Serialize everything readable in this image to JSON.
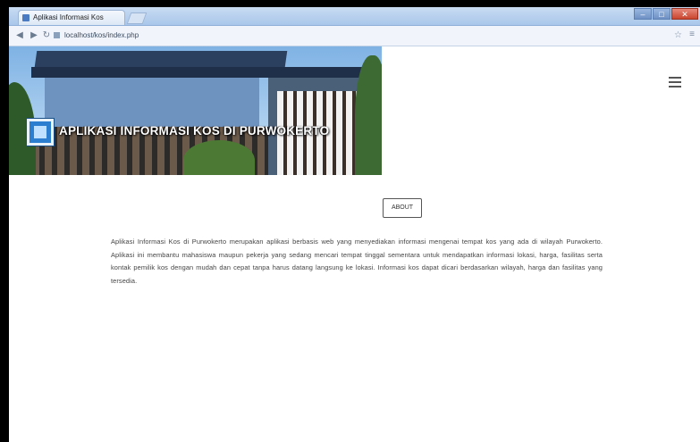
{
  "browser": {
    "tab_title": "Aplikasi Informasi Kos",
    "url": "localhost/kos/index.php",
    "controls": {
      "minimize": "–",
      "maximize": "□",
      "close": "✕"
    },
    "icons": {
      "back": "back-icon",
      "forward": "forward-icon",
      "star": "star-icon",
      "menu": "chrome-menu-icon"
    }
  },
  "header": {
    "title": "APLIKASI INFORMASI KOS DI PURWOKERTO"
  },
  "main": {
    "about_button": "ABOUT",
    "description": "Aplikasi Informasi Kos di Purwokerto merupakan aplikasi berbasis web yang menyediakan informasi mengenai tempat kos yang ada di wilayah Purwokerto. Aplikasi ini membantu mahasiswa maupun pekerja yang sedang mencari tempat tinggal sementara untuk mendapatkan informasi lokasi, harga, fasilitas serta kontak pemilik kos dengan mudah dan cepat tanpa harus datang langsung ke lokasi. Informasi kos dapat dicari berdasarkan wilayah, harga dan fasilitas yang tersedia."
  },
  "colors": {
    "title_bar": "#a9c6ea",
    "page_background": "#ffffff",
    "title_text": "#ffffff"
  }
}
